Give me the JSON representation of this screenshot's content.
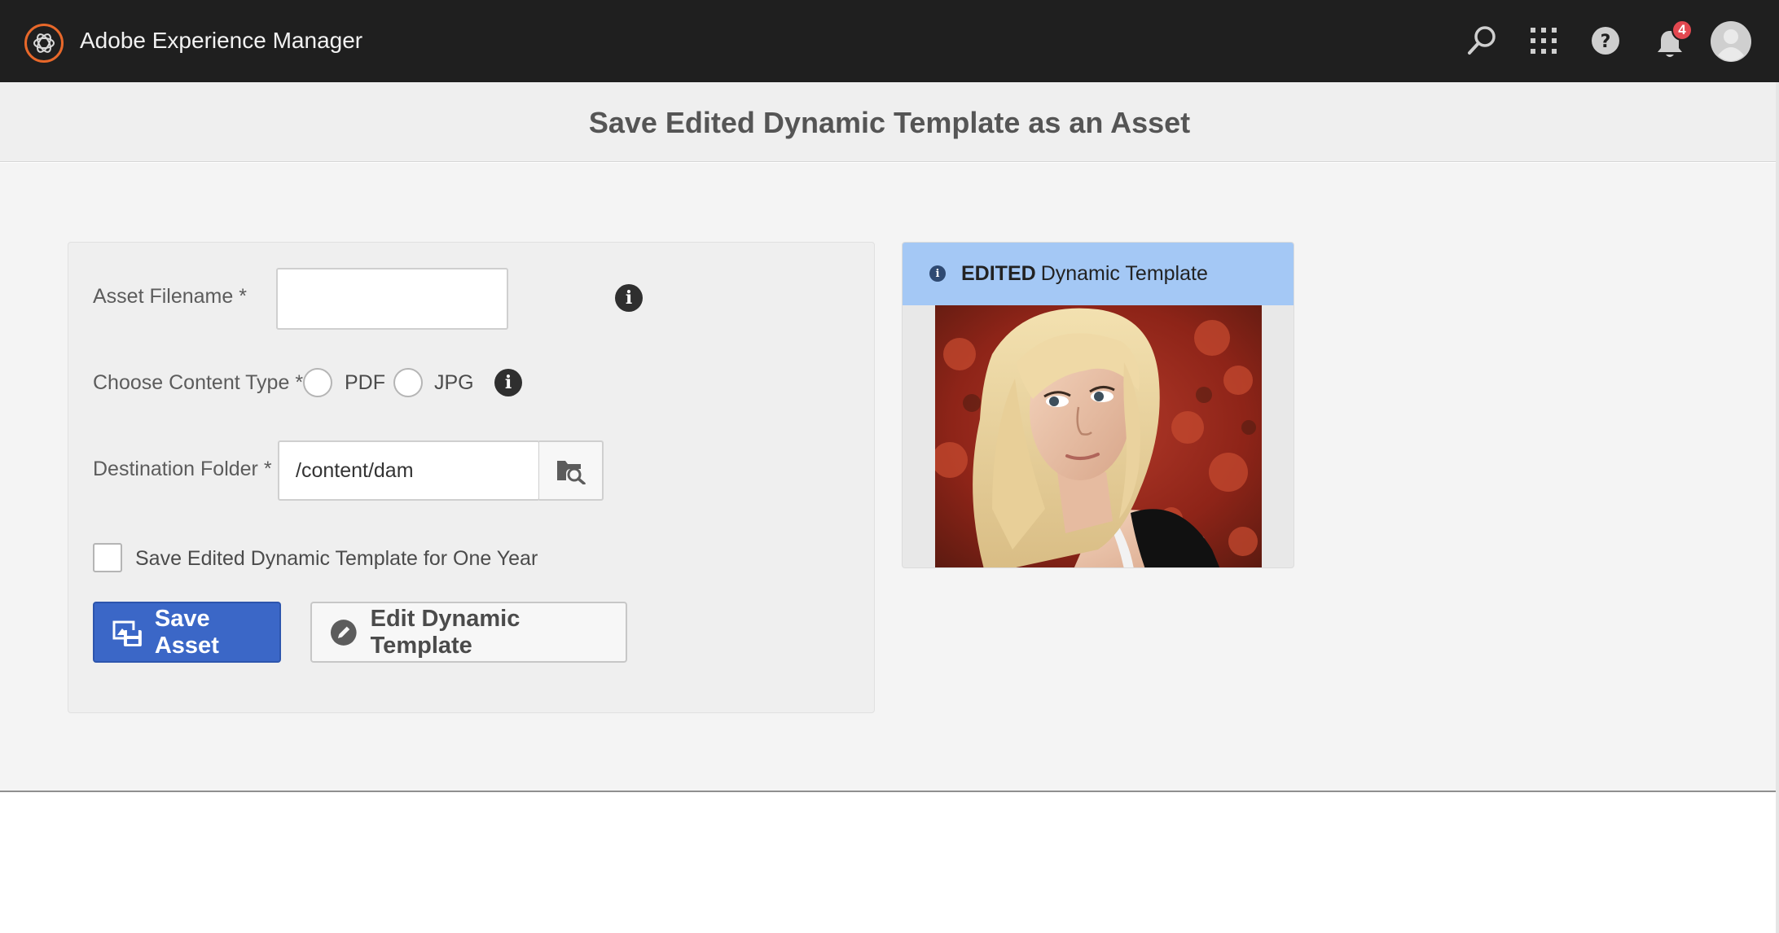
{
  "header": {
    "app_title": "Adobe Experience Manager",
    "notification_count": "4",
    "icons": [
      "experience-manager-logo-icon",
      "search-icon",
      "apps-grid-icon",
      "help-icon",
      "bell-icon",
      "avatar-icon"
    ]
  },
  "page": {
    "title": "Save Edited Dynamic Template as an Asset"
  },
  "form": {
    "filename": {
      "label": "Asset Filename *",
      "value": ""
    },
    "content_type": {
      "label": "Choose Content Type *",
      "options": [
        {
          "label": "PDF",
          "checked": false
        },
        {
          "label": "JPG",
          "checked": false
        }
      ]
    },
    "destination": {
      "label": "Destination Folder *",
      "value": "/content/dam"
    },
    "save_one_year": {
      "label": "Save Edited Dynamic Template for One Year",
      "checked": false
    },
    "save_button": "Save Asset",
    "edit_button": "Edit Dynamic Template"
  },
  "preview": {
    "badge": "EDITED",
    "title": "Dynamic Template"
  },
  "colors": {
    "topbar": "#1f1f1f",
    "primary_button": "#3b67c7",
    "preview_header": "#a4c8f5",
    "badge": "#e34850",
    "logo_accent": "#e8682a"
  }
}
